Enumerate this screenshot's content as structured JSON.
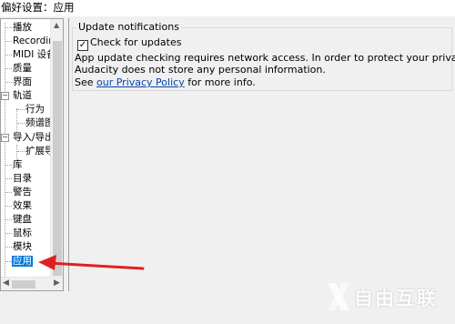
{
  "window": {
    "title": "偏好设置：应用"
  },
  "tree": {
    "items": [
      {
        "label": "播放"
      },
      {
        "label": "Recording"
      },
      {
        "label": "MIDI 设备"
      },
      {
        "label": "质量"
      },
      {
        "label": "界面"
      },
      {
        "label": "轨道",
        "expander": "−"
      },
      {
        "label": "行为"
      },
      {
        "label": "频谱图"
      },
      {
        "label": "导入/导出",
        "expander": "−"
      },
      {
        "label": "扩展导"
      },
      {
        "label": "库"
      },
      {
        "label": "目录"
      },
      {
        "label": "警告"
      },
      {
        "label": "效果"
      },
      {
        "label": "键盘"
      },
      {
        "label": "鼠标"
      },
      {
        "label": "模块"
      },
      {
        "label": "应用",
        "selected": true
      }
    ]
  },
  "panel": {
    "group_title": "Update notifications",
    "checkbox_label": "Check for updates",
    "checkbox_checked": true,
    "desc_line1": "App update checking requires network access. In order to protect your privacy,",
    "desc_line2": "Audacity does not store any personal information.",
    "see_prefix": "See ",
    "privacy_link": "our Privacy Policy",
    "see_suffix": " for more info."
  },
  "annotation": {
    "arrow_color": "#e02020"
  },
  "watermark": {
    "text": "自由互联"
  }
}
